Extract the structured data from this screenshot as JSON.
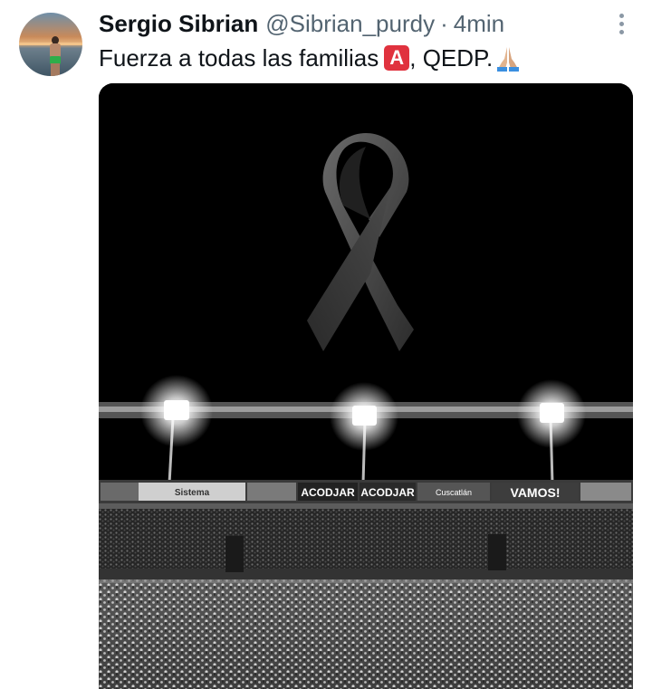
{
  "tweet": {
    "author_name": "Sergio Sibrian",
    "handle": "@Sibrian_purdy",
    "separator": "·",
    "time": "4min",
    "text_part1": "Fuerza a todas las familias",
    "emoji_a": "A",
    "text_part2": ", QEDP.",
    "more_icon": "more-vertical-icon",
    "avatar_icon": "profile-photo"
  },
  "media": {
    "description_icon": "black-ribbon-stadium-image",
    "banners": [
      "Sistema",
      "ACODJAR",
      "ACODJAR",
      "Cuscatlán",
      "VAMOS!"
    ]
  },
  "colors": {
    "text_primary": "#0f1419",
    "text_secondary": "#536471",
    "emoji_red": "#e0323e"
  }
}
